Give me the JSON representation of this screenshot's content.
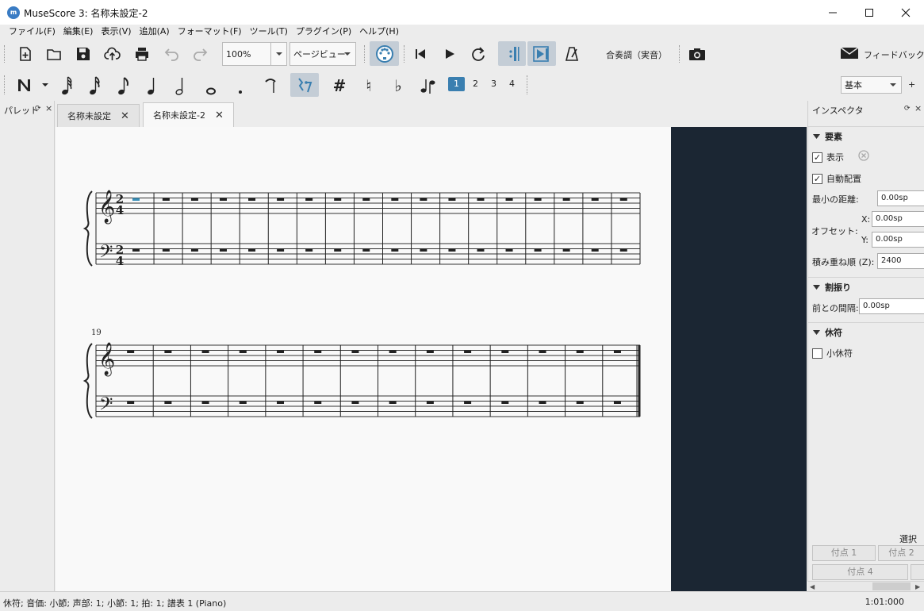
{
  "window": {
    "title": "MuseScore 3: 名称未設定-2",
    "app_icon": "musescore-logo-icon"
  },
  "menubar": {
    "items": [
      "ファイル(F)",
      "編集(E)",
      "表示(V)",
      "追加(A)",
      "フォーマット(F)",
      "ツール(T)",
      "プラグイン(P)",
      "ヘルプ(H)"
    ]
  },
  "toolbar": {
    "zoom_value": "100%",
    "view_mode": "ページビュー",
    "concert_pitch_label": "合奏調（実音）",
    "feedback_label": "フィードバック",
    "workspace_value": "基本",
    "workspace_add": "+",
    "accidentals": [
      "#",
      "♮",
      "♭"
    ],
    "voices": [
      "1",
      "2",
      "3",
      "4"
    ],
    "active_voice": "1"
  },
  "palette": {
    "title": "パレット"
  },
  "tabs": [
    {
      "label": "名称未設定",
      "active": false
    },
    {
      "label": "名称未設定-2",
      "active": true
    }
  ],
  "score": {
    "system2_measure_number": "19",
    "time_signature": {
      "numerator": "2",
      "denominator": "4"
    },
    "system1_measures": 18,
    "system2_measures": 14,
    "canvas_bg": "#1b2633",
    "page_bg": "#f9f9f9",
    "selection_color": "#3a8fb7"
  },
  "inspector": {
    "title": "インスペクタ",
    "element_section": "要素",
    "visible_label": "表示",
    "visible_checked": true,
    "autoplace_label": "自動配置",
    "autoplace_checked": true,
    "min_distance_label": "最小の距離:",
    "min_distance_value": "0.00sp",
    "offset_label": "オフセット:",
    "offset_x_label": "X:",
    "offset_x_value": "0.00sp",
    "offset_y_label": "Y:",
    "offset_y_value": "0.00sp",
    "stacking_label": "積み重ね順 (Z):",
    "stacking_value": "2400",
    "segment_section": "割振り",
    "leading_space_label": "前との間隔:",
    "leading_space_value": "0.00sp",
    "rest_section": "休符",
    "small_rest_label": "小休符",
    "small_rest_checked": false,
    "select_label": "選択",
    "attach1": "付点 1",
    "attach2": "付点 2",
    "attach4": "付点 4"
  },
  "statusbar": {
    "left": "休符; 音価: 小節; 声部: 1;  小節: 1; 拍: 1; 譜表 1 (Piano)",
    "right": "1:01:000"
  }
}
